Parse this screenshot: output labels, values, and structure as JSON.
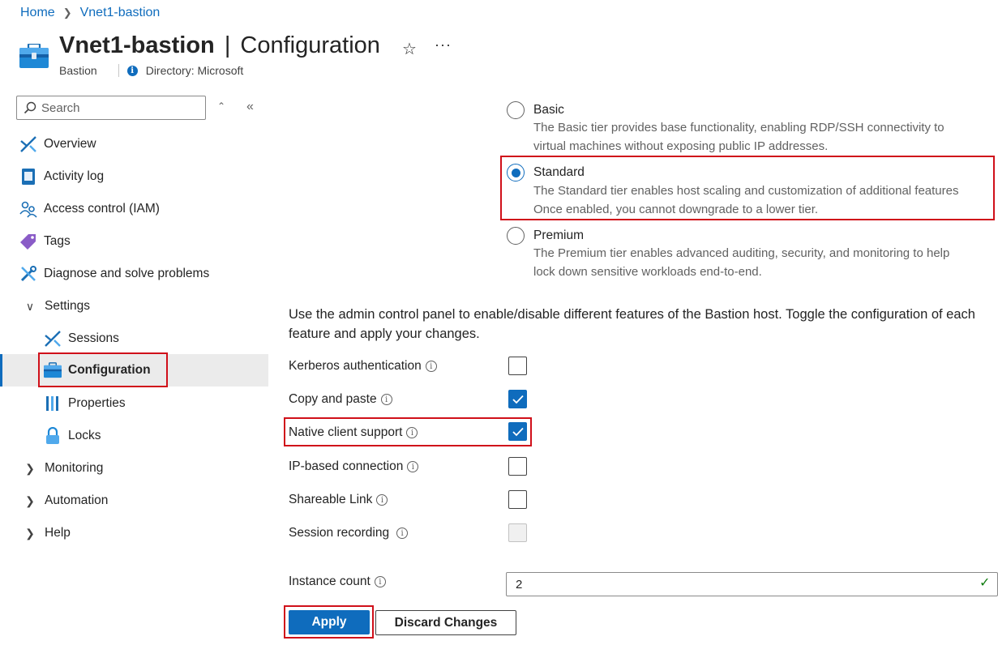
{
  "breadcrumb": {
    "items": [
      "Home",
      "Vnet1-bastion"
    ]
  },
  "header": {
    "resource_name": "Vnet1-bastion",
    "separator": "|",
    "page_name": "Configuration",
    "resource_type": "Bastion",
    "directory": "Directory: Microsoft",
    "star_icon": "star-icon",
    "more_icon": "more-icon"
  },
  "sidebar": {
    "search_placeholder": "Search",
    "items": [
      {
        "label": "Overview",
        "icon": "overview-icon"
      },
      {
        "label": "Activity log",
        "icon": "activity-log-icon"
      },
      {
        "label": "Access control (IAM)",
        "icon": "iam-icon"
      },
      {
        "label": "Tags",
        "icon": "tag-icon"
      },
      {
        "label": "Diagnose and solve problems",
        "icon": "wrench-icon"
      },
      {
        "label": "Settings",
        "expanded": true
      },
      {
        "label": "Sessions",
        "icon": "sessions-icon"
      },
      {
        "label": "Configuration",
        "icon": "configuration-icon",
        "selected": true
      },
      {
        "label": "Properties",
        "icon": "properties-icon"
      },
      {
        "label": "Locks",
        "icon": "lock-icon"
      },
      {
        "label": "Monitoring",
        "expanded": false
      },
      {
        "label": "Automation",
        "expanded": false
      },
      {
        "label": "Help",
        "expanded": false
      }
    ]
  },
  "tiers": [
    {
      "name": "Basic",
      "description": [
        "The Basic tier provides base functionality, enabling RDP/SSH connectivity to",
        "virtual machines without exposing public IP addresses."
      ],
      "selected": false
    },
    {
      "name": "Standard",
      "description": [
        "The Standard tier enables host scaling and customization of additional features",
        "Once enabled, you cannot downgrade to a lower tier."
      ],
      "selected": true
    },
    {
      "name": "Premium",
      "description": [
        "The Premium tier enables advanced auditing, security, and monitoring to help",
        "lock down sensitive workloads end-to-end."
      ],
      "selected": false
    }
  ],
  "features_intro": "Use the admin control panel to enable/disable different features of the Bastion host. Toggle the configuration of each feature and apply your changes.",
  "features": [
    {
      "label": "Kerberos authentication",
      "checked": false,
      "disabled": false
    },
    {
      "label": "Copy and paste",
      "checked": true,
      "disabled": false
    },
    {
      "label": "Native client support",
      "checked": true,
      "disabled": false
    },
    {
      "label": "IP-based connection",
      "checked": false,
      "disabled": false
    },
    {
      "label": "Shareable Link",
      "checked": false,
      "disabled": false
    },
    {
      "label": "Session recording",
      "checked": false,
      "disabled": true
    }
  ],
  "instance_count": {
    "label": "Instance count",
    "value": "2",
    "valid": true
  },
  "buttons": {
    "apply": "Apply",
    "discard": "Discard Changes"
  },
  "colors": {
    "accent": "#0f6cbd",
    "highlight": "#d0101a",
    "valid": "#107c10"
  }
}
